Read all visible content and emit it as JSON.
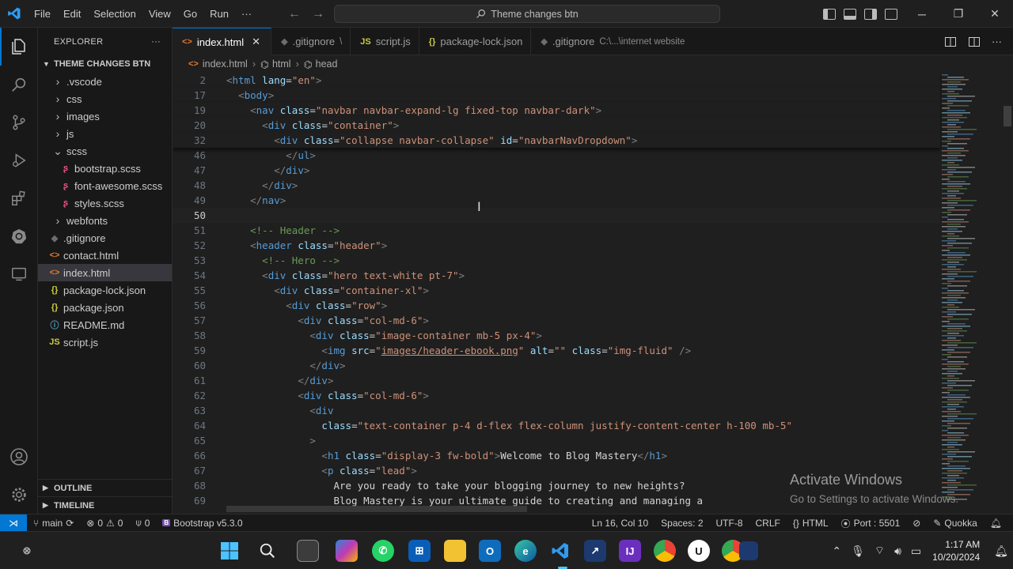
{
  "titlebar": {
    "menu": [
      "File",
      "Edit",
      "Selection",
      "View",
      "Go",
      "Run",
      "···"
    ],
    "search": "Theme changes btn"
  },
  "sidebar": {
    "title": "EXPLORER",
    "more": "···",
    "root": "THEME CHANGES BTN",
    "items": [
      {
        "label": ".vscode",
        "kind": "folder",
        "icon": "chevron-right-icon"
      },
      {
        "label": "css",
        "kind": "folder",
        "icon": "chevron-right-icon"
      },
      {
        "label": "images",
        "kind": "folder",
        "icon": "chevron-right-icon"
      },
      {
        "label": "js",
        "kind": "folder",
        "icon": "chevron-right-icon"
      },
      {
        "label": "scss",
        "kind": "folder-open",
        "icon": "chevron-down-icon"
      },
      {
        "label": "bootstrap.scss",
        "kind": "scss-file",
        "icon": "sass-icon"
      },
      {
        "label": "font-awesome.scss",
        "kind": "scss-file",
        "icon": "sass-icon"
      },
      {
        "label": "styles.scss",
        "kind": "scss-file",
        "icon": "sass-icon"
      },
      {
        "label": "webfonts",
        "kind": "folder",
        "icon": "chevron-right-icon"
      },
      {
        "label": ".gitignore",
        "kind": "git-file",
        "icon": "git-icon"
      },
      {
        "label": "contact.html",
        "kind": "html-file",
        "icon": "html-icon"
      },
      {
        "label": "index.html",
        "kind": "html-file",
        "icon": "html-icon",
        "selected": true
      },
      {
        "label": "package-lock.json",
        "kind": "json-file",
        "icon": "json-icon"
      },
      {
        "label": "package.json",
        "kind": "json-file",
        "icon": "json-icon"
      },
      {
        "label": "README.md",
        "kind": "info-file",
        "icon": "info-icon"
      },
      {
        "label": "script.js",
        "kind": "js-file",
        "icon": "js-icon"
      }
    ],
    "outline": "OUTLINE",
    "timeline": "TIMELINE"
  },
  "tabs": [
    {
      "label": "index.html",
      "icon": "<>",
      "active": true,
      "close": "✕"
    },
    {
      "label": ".gitignore",
      "icon": "◆",
      "desc": "\\"
    },
    {
      "label": "script.js",
      "icon": "JS"
    },
    {
      "label": "package-lock.json",
      "icon": "{}"
    },
    {
      "label": ".gitignore",
      "icon": "◆",
      "desc": "C:\\...\\internet website"
    }
  ],
  "breadcrumb": [
    "index.html",
    "html",
    "head"
  ],
  "editor": {
    "lines": [
      {
        "n": "2",
        "sticky": true,
        "html": "<span class='t-brk'>&lt;</span><span class='t-tag'>html</span> <span class='t-attr'>lang</span>=<span class='t-str'>\"en\"</span><span class='t-brk'>&gt;</span>",
        "indent": 0
      },
      {
        "n": "17",
        "sticky": true,
        "html": "<span class='t-brk'>&lt;</span><span class='t-tag'>body</span><span class='t-brk'>&gt;</span>",
        "indent": 1
      },
      {
        "n": "19",
        "sticky": true,
        "html": "<span class='t-brk'>&lt;</span><span class='t-tag'>nav</span> <span class='t-attr'>class</span>=<span class='t-str'>\"navbar navbar-expand-lg fixed-top navbar-dark\"</span><span class='t-brk'>&gt;</span>",
        "indent": 2
      },
      {
        "n": "20",
        "sticky": true,
        "html": "<span class='t-brk'>&lt;</span><span class='t-tag'>div</span> <span class='t-attr'>class</span>=<span class='t-str'>\"container\"</span><span class='t-brk'>&gt;</span>",
        "indent": 3
      },
      {
        "n": "32",
        "sticky": true,
        "html": "<span class='t-brk'>&lt;</span><span class='t-tag'>div</span> <span class='t-attr'>class</span>=<span class='t-str'>\"collapse navbar-collapse\"</span> <span class='t-attr'>id</span>=<span class='t-str'>\"navbarNavDropdown\"</span><span class='t-brk'>&gt;</span>",
        "indent": 4
      },
      {
        "n": "46",
        "html": "<span class='t-brk'>&lt;/</span><span class='t-tag'>ul</span><span class='t-brk'>&gt;</span>",
        "indent": 5
      },
      {
        "n": "47",
        "html": "<span class='t-brk'>&lt;/</span><span class='t-tag'>div</span><span class='t-brk'>&gt;</span>",
        "indent": 4
      },
      {
        "n": "48",
        "html": "<span class='t-brk'>&lt;/</span><span class='t-tag'>div</span><span class='t-brk'>&gt;</span>",
        "indent": 3
      },
      {
        "n": "49",
        "html": "<span class='t-brk'>&lt;/</span><span class='t-tag'>nav</span><span class='t-brk'>&gt;</span>",
        "indent": 2
      },
      {
        "n": "50",
        "html": "",
        "indent": 0,
        "current": true
      },
      {
        "n": "51",
        "html": "<span class='t-com'>&lt;!-- Header --&gt;</span>",
        "indent": 2
      },
      {
        "n": "52",
        "html": "<span class='t-brk'>&lt;</span><span class='t-tag'>header</span> <span class='t-attr'>class</span>=<span class='t-str'>\"header\"</span><span class='t-brk'>&gt;</span>",
        "indent": 2
      },
      {
        "n": "53",
        "html": "<span class='t-com'>&lt;!-- Hero --&gt;</span>",
        "indent": 3
      },
      {
        "n": "54",
        "html": "<span class='t-brk'>&lt;</span><span class='t-tag'>div</span> <span class='t-attr'>class</span>=<span class='t-str'>\"hero text-white pt-7\"</span><span class='t-brk'>&gt;</span>",
        "indent": 3
      },
      {
        "n": "55",
        "html": "<span class='t-brk'>&lt;</span><span class='t-tag'>div</span> <span class='t-attr'>class</span>=<span class='t-str'>\"container-xl\"</span><span class='t-brk'>&gt;</span>",
        "indent": 4
      },
      {
        "n": "56",
        "html": "<span class='t-brk'>&lt;</span><span class='t-tag'>div</span> <span class='t-attr'>class</span>=<span class='t-str'>\"row\"</span><span class='t-brk'>&gt;</span>",
        "indent": 5
      },
      {
        "n": "57",
        "html": "<span class='t-brk'>&lt;</span><span class='t-tag'>div</span> <span class='t-attr'>class</span>=<span class='t-str'>\"col-md-6\"</span><span class='t-brk'>&gt;</span>",
        "indent": 6
      },
      {
        "n": "58",
        "html": "<span class='t-brk'>&lt;</span><span class='t-tag'>div</span> <span class='t-attr'>class</span>=<span class='t-str'>\"image-container mb-5 px-4\"</span><span class='t-brk'>&gt;</span>",
        "indent": 7
      },
      {
        "n": "59",
        "html": "<span class='t-brk'>&lt;</span><span class='t-tag'>img</span> <span class='t-attr'>src</span>=<span class='t-str'>\"</span><span class='t-link'>images/header-ebook.png</span><span class='t-str'>\"</span> <span class='t-attr'>alt</span>=<span class='t-str'>\"\"</span> <span class='t-attr'>class</span>=<span class='t-str'>\"img-fluid\"</span> <span class='t-brk'>/&gt;</span>",
        "indent": 8
      },
      {
        "n": "60",
        "html": "<span class='t-brk'>&lt;/</span><span class='t-tag'>div</span><span class='t-brk'>&gt;</span>",
        "indent": 7
      },
      {
        "n": "61",
        "html": "<span class='t-brk'>&lt;/</span><span class='t-tag'>div</span><span class='t-brk'>&gt;</span>",
        "indent": 6
      },
      {
        "n": "62",
        "html": "<span class='t-brk'>&lt;</span><span class='t-tag'>div</span> <span class='t-attr'>class</span>=<span class='t-str'>\"col-md-6\"</span><span class='t-brk'>&gt;</span>",
        "indent": 6
      },
      {
        "n": "63",
        "html": "<span class='t-brk'>&lt;</span><span class='t-tag'>div</span>",
        "indent": 7
      },
      {
        "n": "64",
        "html": "<span class='t-attr'>class</span>=<span class='t-str'>\"text-container p-4 d-flex flex-column justify-content-center h-100 mb-5\"</span>",
        "indent": 8
      },
      {
        "n": "65",
        "html": "<span class='t-brk'>&gt;</span>",
        "indent": 7
      },
      {
        "n": "66",
        "html": "<span class='t-brk'>&lt;</span><span class='t-tag'>h1</span> <span class='t-attr'>class</span>=<span class='t-str'>\"display-3 fw-bold\"</span><span class='t-brk'>&gt;</span><span class='t-txt'>Welcome to Blog Mastery</span><span class='t-brk'>&lt;/</span><span class='t-tag'>h1</span><span class='t-brk'>&gt;</span>",
        "indent": 8
      },
      {
        "n": "67",
        "html": "<span class='t-brk'>&lt;</span><span class='t-tag'>p</span> <span class='t-attr'>class</span>=<span class='t-str'>\"lead\"</span><span class='t-brk'>&gt;</span>",
        "indent": 8
      },
      {
        "n": "68",
        "html": "<span class='t-txt'>Are you ready to take your blogging journey to new heights?</span>",
        "indent": 9
      },
      {
        "n": "69",
        "html": "<span class='t-txt'>Blog Mastery is your ultimate guide to creating and managing a</span>",
        "indent": 9
      }
    ]
  },
  "watermark": {
    "title": "Activate Windows",
    "subtitle": "Go to Settings to activate Windows."
  },
  "statusbar": {
    "branch": "main",
    "errors": "0",
    "warnings": "0",
    "ports": "0",
    "extension": "Bootstrap v5.3.0",
    "position": "Ln 16, Col 10",
    "spaces": "Spaces: 2",
    "encoding": "UTF-8",
    "eol": "CRLF",
    "language": "HTML",
    "port": "Port : 5501",
    "quokka": "Quokka"
  },
  "taskbar": {
    "time": "1:17 AM",
    "date": "10/20/2024"
  },
  "colors": {
    "accent": "#0078d4",
    "background": "#1f1f1f"
  }
}
